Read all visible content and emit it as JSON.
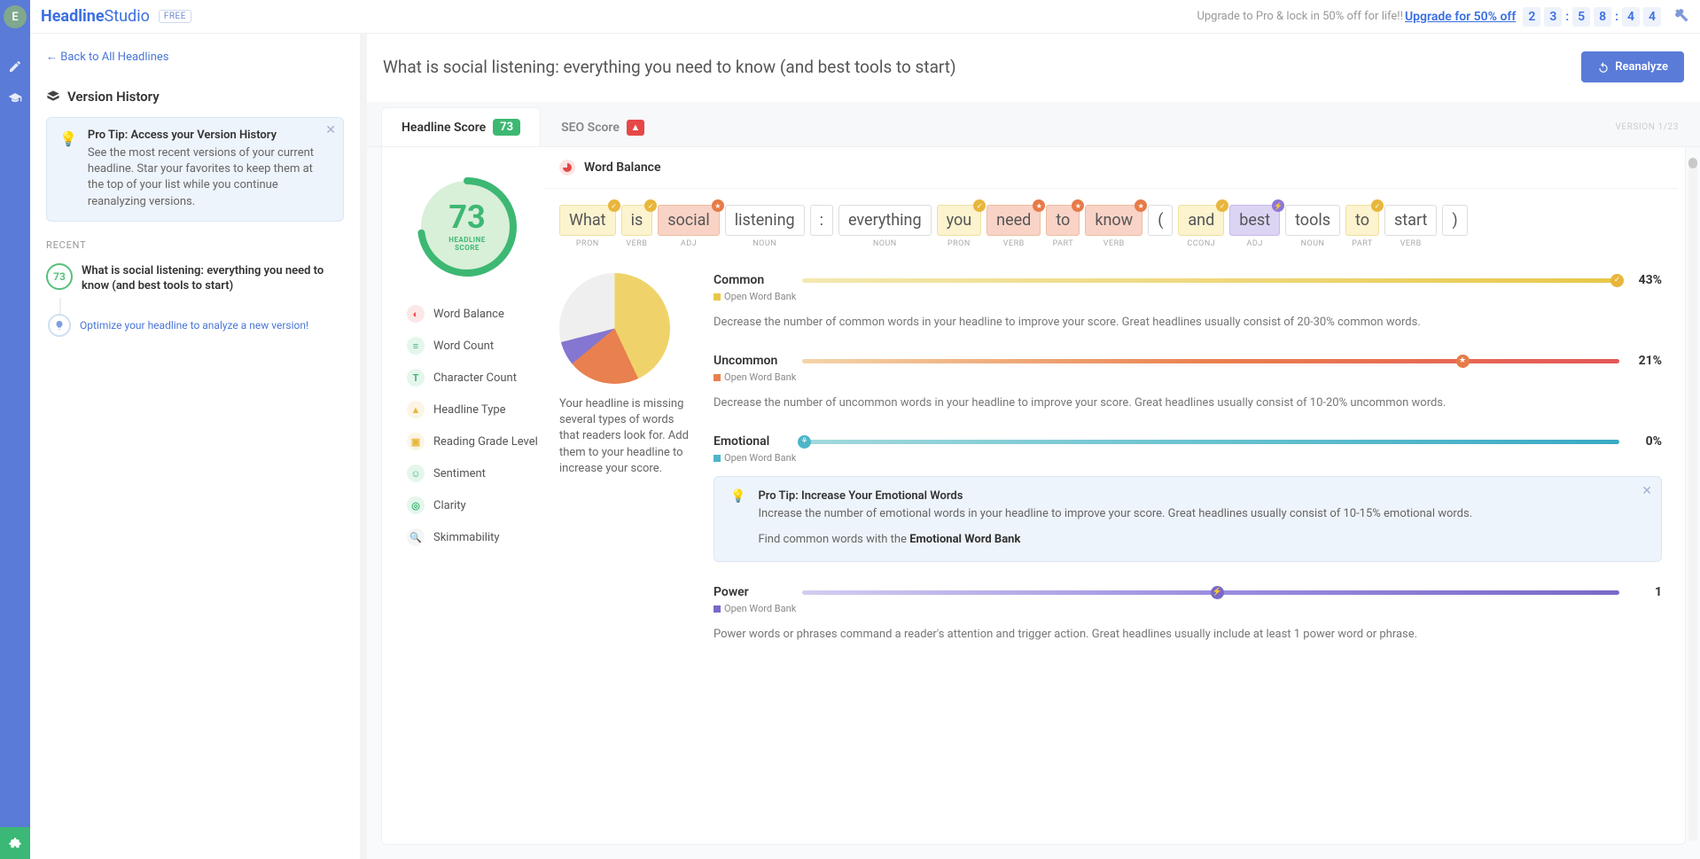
{
  "brand": {
    "left": "Headline",
    "right": "Studio",
    "badge": "FREE"
  },
  "upgrade": {
    "text": "Upgrade to Pro & lock in 50% off for life!! ",
    "link": "Upgrade for 50% off"
  },
  "countdown": {
    "d1": "2",
    "d2": "3",
    "h1": "5",
    "h2": "8",
    "m1": "4",
    "m2": "4"
  },
  "avatar_letter": "E",
  "sidebar": {
    "back": "← Back to All Headlines",
    "vh_title": "Version History",
    "protip_title": "Pro Tip: Access your Version History",
    "protip_body": "See the most recent versions of your current headline. Star your favorites to keep them at the top of your list while you continue reanalyzing versions.",
    "recent": "RECENT",
    "item_score": "73",
    "item_title": "What is social listening: everything you need to know (and best tools to start)",
    "optimize": "Optimize your headline to analyze a new version!"
  },
  "main": {
    "headline": "What is social listening: everything you need to know (and best tools to start)",
    "reanalyze": "Reanalyze",
    "version_label": "VERSION 1/23",
    "tab1": "Headline Score",
    "tab1_badge": "73",
    "tab2": "SEO Score",
    "score_big": "73",
    "score_lbl": "HEADLINE\nSCORE",
    "metrics": [
      {
        "label": "Word Balance",
        "color": "#e64848",
        "glyph": "◐"
      },
      {
        "label": "Word Count",
        "color": "#3db873",
        "glyph": "≡"
      },
      {
        "label": "Character Count",
        "color": "#3db873",
        "glyph": "T"
      },
      {
        "label": "Headline Type",
        "color": "#e8b63c",
        "glyph": "▲"
      },
      {
        "label": "Reading Grade Level",
        "color": "#e8b63c",
        "glyph": "▣"
      },
      {
        "label": "Sentiment",
        "color": "#3db873",
        "glyph": "☺"
      },
      {
        "label": "Clarity",
        "color": "#3db873",
        "glyph": "◎"
      },
      {
        "label": "Skimmability",
        "color": "#b5b5b5",
        "glyph": "🔍"
      }
    ],
    "section_title": "Word Balance",
    "words": [
      {
        "t": "What",
        "cls": "yellow",
        "b": "y",
        "pos": "PRON"
      },
      {
        "t": "is",
        "cls": "yellow",
        "b": "y",
        "pos": "VERB"
      },
      {
        "t": "social",
        "cls": "orange",
        "b": "o",
        "pos": "ADJ"
      },
      {
        "t": "listening",
        "cls": "",
        "b": "",
        "pos": "NOUN"
      },
      {
        "t": ":",
        "cls": "",
        "b": "",
        "pos": ""
      },
      {
        "t": "everything",
        "cls": "",
        "b": "",
        "pos": "NOUN"
      },
      {
        "t": "you",
        "cls": "yellow",
        "b": "y",
        "pos": "PRON"
      },
      {
        "t": "need",
        "cls": "orange",
        "b": "o",
        "pos": "VERB"
      },
      {
        "t": "to",
        "cls": "orange",
        "b": "o",
        "pos": "PART"
      },
      {
        "t": "know",
        "cls": "orange",
        "b": "o",
        "pos": "VERB"
      },
      {
        "t": "(",
        "cls": "",
        "b": "",
        "pos": ""
      },
      {
        "t": "and",
        "cls": "yellow",
        "b": "y",
        "pos": "CCONJ"
      },
      {
        "t": "best",
        "cls": "purple",
        "b": "p",
        "pos": "ADJ"
      },
      {
        "t": "tools",
        "cls": "",
        "b": "",
        "pos": "NOUN"
      },
      {
        "t": "to",
        "cls": "yellow",
        "b": "y",
        "pos": "PART"
      },
      {
        "t": "start",
        "cls": "",
        "b": "",
        "pos": "VERB"
      },
      {
        "t": ")",
        "cls": "",
        "b": "",
        "pos": ""
      }
    ],
    "pie_desc": "Your headline is missing several types of words that readers look for. Add them to your headline to increase your score.",
    "open_bank": "Open Word Bank",
    "bars": {
      "common": {
        "label": "Common",
        "pct": "43%",
        "desc": "Decrease the number of common words in your headline to improve your score. Great headlines usually consist of 20-30% common words."
      },
      "uncommon": {
        "label": "Uncommon",
        "pct": "21%",
        "desc": "Decrease the number of uncommon words in your headline to improve your score. Great headlines usually consist of 10-20% uncommon words."
      },
      "emotional": {
        "label": "Emotional",
        "pct": "0%",
        "tip_title": "Pro Tip: Increase Your Emotional Words",
        "tip_body": "Increase the number of emotional words in your headline to improve your score. Great headlines usually consist of 10-15% emotional words.",
        "tip_body2": "Find common words with the ",
        "tip_link": "Emotional Word Bank"
      },
      "power": {
        "label": "Power",
        "pct": "1",
        "desc": "Power words or phrases command a reader's attention and trigger action. Great headlines usually include at least 1 power word or phrase."
      }
    }
  },
  "chart_data": {
    "type": "pie",
    "title": "Word Balance",
    "series": [
      {
        "name": "Common",
        "value": 43,
        "color": "#efd36a"
      },
      {
        "name": "Uncommon",
        "value": 21,
        "color": "#e9804f"
      },
      {
        "name": "Power",
        "value": 7,
        "color": "#8476d1"
      },
      {
        "name": "Other",
        "value": 29,
        "color": "#efefef"
      }
    ],
    "bars": [
      {
        "name": "Common",
        "value": 43,
        "unit": "%",
        "target": "20-30%"
      },
      {
        "name": "Uncommon",
        "value": 21,
        "unit": "%",
        "target": "10-20%"
      },
      {
        "name": "Emotional",
        "value": 0,
        "unit": "%",
        "target": "10-15%"
      },
      {
        "name": "Power",
        "value": 1,
        "unit": "count",
        "target": "≥1"
      }
    ]
  }
}
